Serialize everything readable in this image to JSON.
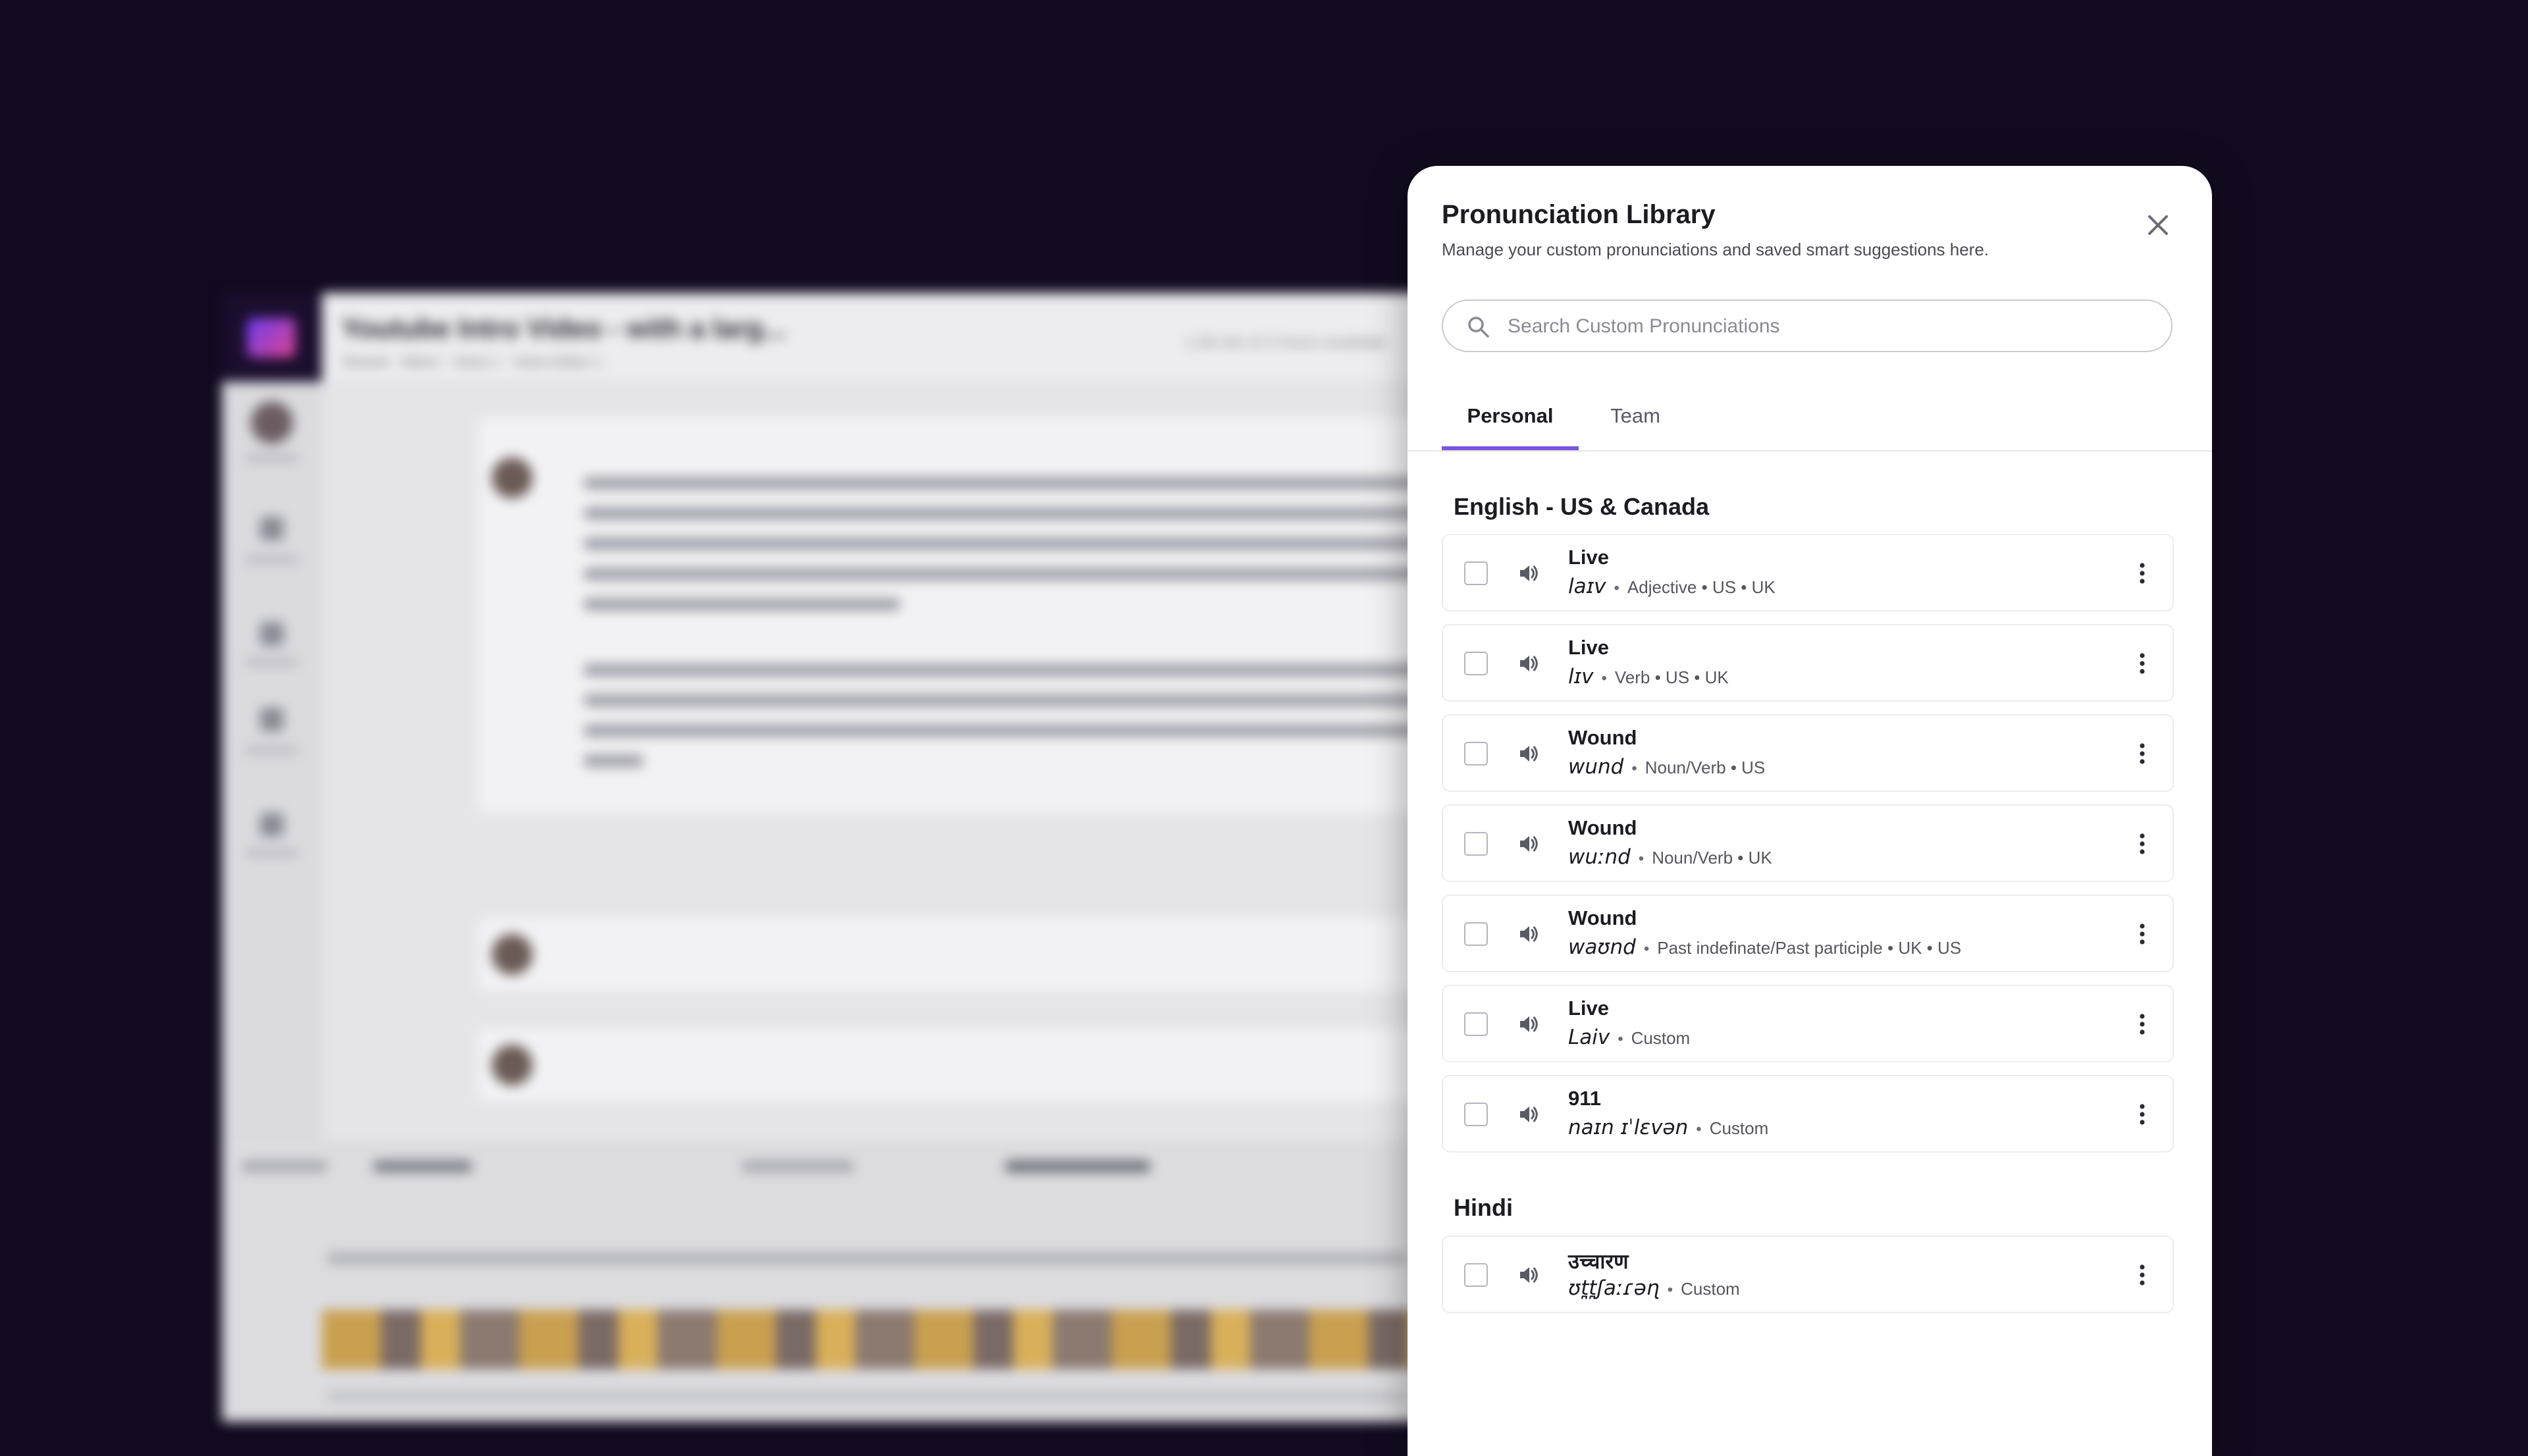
{
  "background": {
    "video_title": "Youtube Intro Video - with a larg...",
    "header_chips": "Shared  ·  Aliens  ·  Voice 1  ·  Voice Editor 1",
    "header_right": "1:38 min of 3 hours available"
  },
  "modal": {
    "title": "Pronunciation Library",
    "subtitle": "Manage your custom pronunciations and saved smart suggestions here.",
    "search_placeholder": "Search Custom Pronunciations",
    "tabs": [
      {
        "label": "Personal",
        "active": true
      },
      {
        "label": "Team",
        "active": false
      }
    ],
    "accent_color": "#7a55dd",
    "sections": [
      {
        "heading": "English - US & Canada",
        "items": [
          {
            "word": "Live",
            "ipa": "laɪv",
            "meta": "Adjective • US • UK"
          },
          {
            "word": "Live",
            "ipa": "lɪv",
            "meta": "Verb • US • UK"
          },
          {
            "word": "Wound",
            "ipa": "wund",
            "meta": "Noun/Verb • US"
          },
          {
            "word": "Wound",
            "ipa": "wuːnd",
            "meta": "Noun/Verb • UK"
          },
          {
            "word": "Wound",
            "ipa": "waʊnd",
            "meta": "Past indefinate/Past participle • UK • US"
          },
          {
            "word": "Live",
            "ipa": "Laiv",
            "meta": "Custom"
          },
          {
            "word": "911",
            "ipa": "naɪn ɪˈlɛvən",
            "meta": "Custom"
          }
        ]
      },
      {
        "heading": "Hindi",
        "items": [
          {
            "word": "उच्चारण",
            "ipa": "ʊt̪t̪ʃaːɾəɳ",
            "meta": "Custom"
          }
        ]
      }
    ],
    "separator": "•",
    "icons": {
      "close": "close-icon",
      "search": "search-icon",
      "audio": "speaker-icon",
      "menu": "more-vertical-icon"
    }
  }
}
